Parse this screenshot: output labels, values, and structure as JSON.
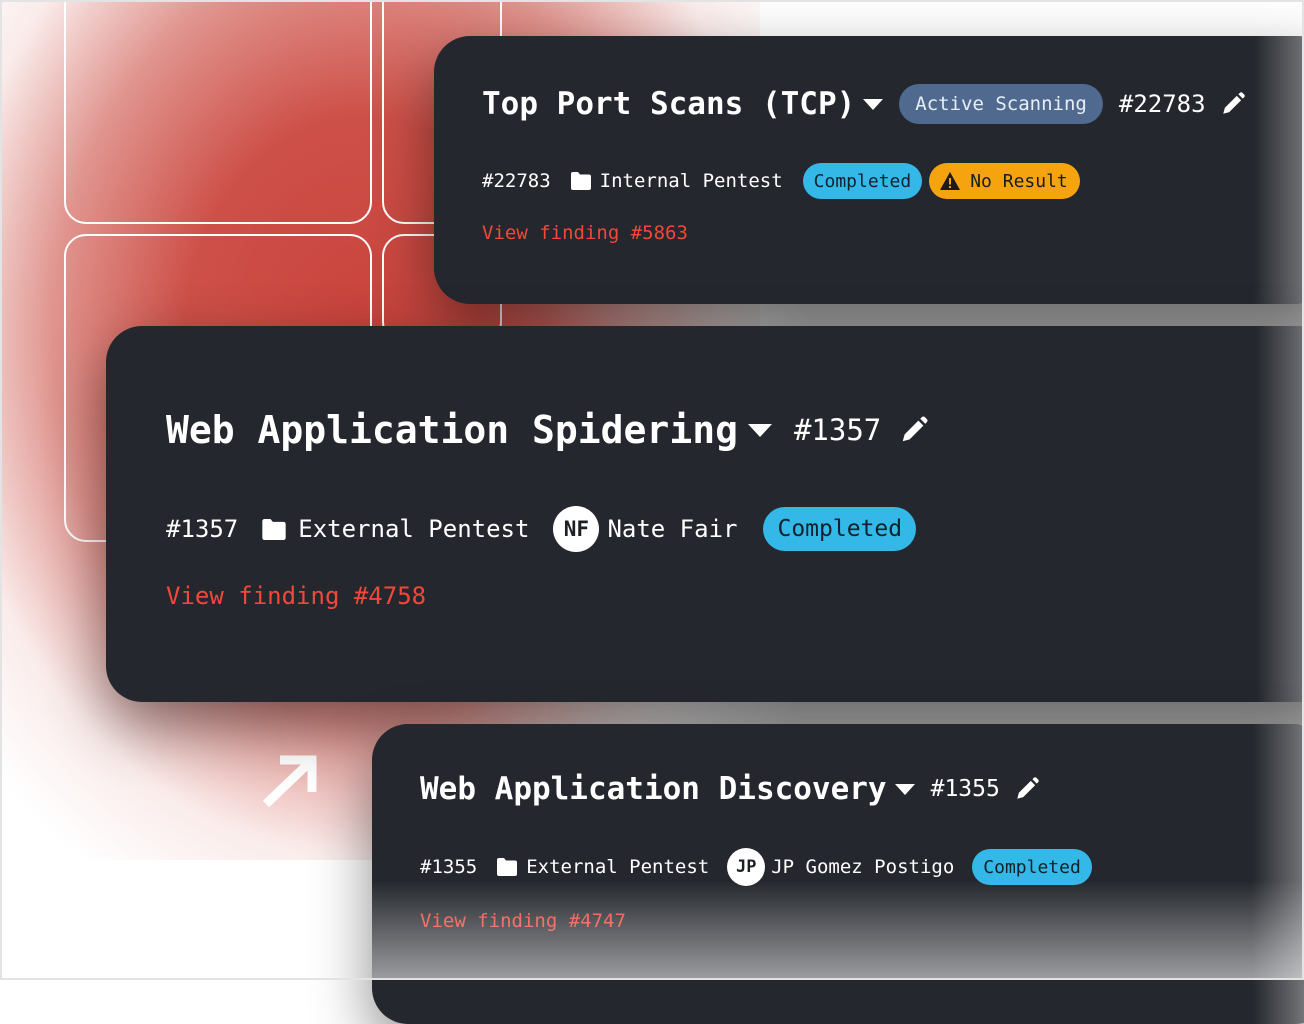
{
  "colors": {
    "card_bg": "#24272d",
    "accent_red": "#f2483a",
    "badge_active": "#4f6a8e",
    "badge_completed": "#33b8e8",
    "badge_no_result": "#f5a40f",
    "glow_red": "#c9433c"
  },
  "cards": [
    {
      "title": "Top Port Scans (TCP)",
      "status_badge": "Active Scanning",
      "id": "#22783",
      "meta_id": "#22783",
      "project": "Internal Pentest",
      "badges": [
        "Completed",
        "No Result"
      ],
      "link": "View finding #5863"
    },
    {
      "title": "Web Application Spidering",
      "id": "#1357",
      "meta_id": "#1357",
      "project": "External Pentest",
      "avatar_initials": "NF",
      "assignee": "Nate Fair",
      "badges": [
        "Completed"
      ],
      "link": "View finding #4758"
    },
    {
      "title": "Web Application Discovery",
      "id": "#1355",
      "meta_id": "#1355",
      "project": "External Pentest",
      "avatar_initials": "JP",
      "assignee": "JP Gomez Postigo",
      "badges": [
        "Completed"
      ],
      "link": "View finding #4747"
    }
  ],
  "icons": [
    "chevron-down-icon",
    "pencil-icon",
    "folder-icon",
    "warning-icon",
    "arrow-up-right-icon"
  ]
}
